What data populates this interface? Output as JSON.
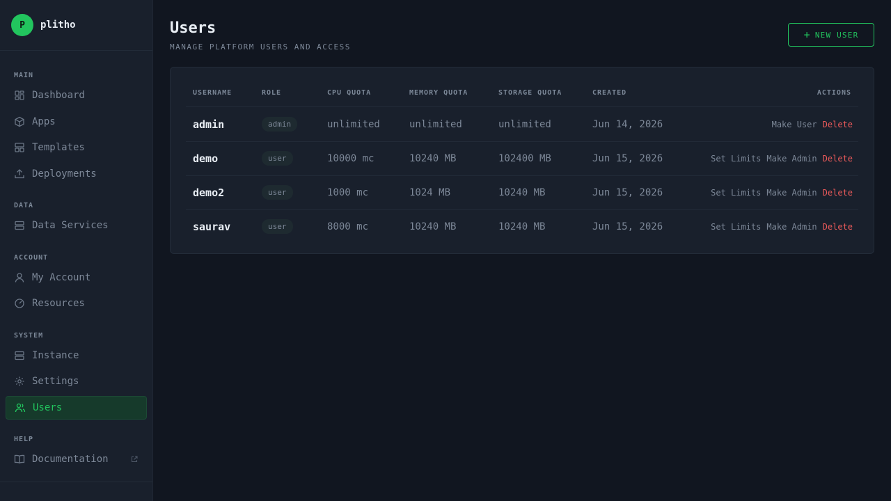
{
  "brand": {
    "logo_letter": "P",
    "name": "plitho"
  },
  "sidebar": {
    "sections": {
      "main": "MAIN",
      "data": "DATA",
      "account": "ACCOUNT",
      "system": "SYSTEM",
      "help": "HELP"
    },
    "items": {
      "dashboard": "Dashboard",
      "apps": "Apps",
      "templates": "Templates",
      "deployments": "Deployments",
      "data_services": "Data Services",
      "my_account": "My Account",
      "resources": "Resources",
      "instance": "Instance",
      "settings": "Settings",
      "users": "Users",
      "documentation": "Documentation"
    },
    "active": "users"
  },
  "header": {
    "title": "Users",
    "subtitle": "MANAGE PLATFORM USERS AND ACCESS",
    "new_user_label": "NEW USER"
  },
  "table": {
    "columns": [
      "USERNAME",
      "ROLE",
      "CPU QUOTA",
      "MEMORY QUOTA",
      "STORAGE QUOTA",
      "CREATED",
      "ACTIONS"
    ],
    "rows": [
      {
        "username": "admin",
        "role": "admin",
        "cpu": "unlimited",
        "memory": "unlimited",
        "storage": "unlimited",
        "created": "Jun 14, 2026",
        "actions": [
          "Make User",
          "Delete"
        ]
      },
      {
        "username": "demo",
        "role": "user",
        "cpu": "10000 mc",
        "memory": "10240 MB",
        "storage": "102400 MB",
        "created": "Jun 15, 2026",
        "actions": [
          "Set Limits",
          "Make Admin",
          "Delete"
        ]
      },
      {
        "username": "demo2",
        "role": "user",
        "cpu": "1000 mc",
        "memory": "1024 MB",
        "storage": "10240 MB",
        "created": "Jun 15, 2026",
        "actions": [
          "Set Limits",
          "Make Admin",
          "Delete"
        ]
      },
      {
        "username": "saurav",
        "role": "user",
        "cpu": "8000 mc",
        "memory": "10240 MB",
        "storage": "10240 MB",
        "created": "Jun 15, 2026",
        "actions": [
          "Set Limits",
          "Make Admin",
          "Delete"
        ]
      }
    ]
  },
  "colors": {
    "accent": "#22c55e",
    "danger": "#ef5b5b",
    "background": "#111620",
    "sidebar": "#19202c"
  }
}
